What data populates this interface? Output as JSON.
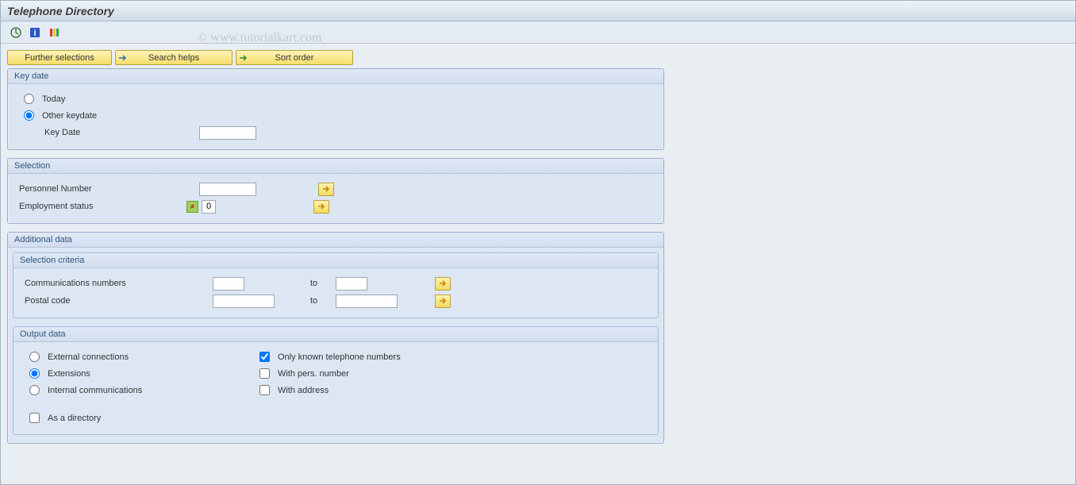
{
  "title": "Telephone Directory",
  "watermark": "© www.tutorialkart.com",
  "buttons": {
    "further": "Further selections",
    "search": "Search helps",
    "sort": "Sort order"
  },
  "panels": {
    "keydate": {
      "title": "Key date",
      "today": "Today",
      "other": "Other keydate",
      "keydate_label": "Key Date"
    },
    "selection": {
      "title": "Selection",
      "personnel": "Personnel Number",
      "employment": "Employment status",
      "employment_value": "0"
    },
    "additional": {
      "title": "Additional data",
      "criteria": {
        "title": "Selection criteria",
        "comm": "Communications numbers",
        "postal": "Postal code",
        "to": "to"
      },
      "output": {
        "title": "Output data",
        "external": "External connections",
        "extensions": "Extensions",
        "internal": "Internal communications",
        "only_known": "Only known telephone numbers",
        "with_pers": "With pers. number",
        "with_address": "With address",
        "as_directory": "As a directory"
      }
    }
  }
}
